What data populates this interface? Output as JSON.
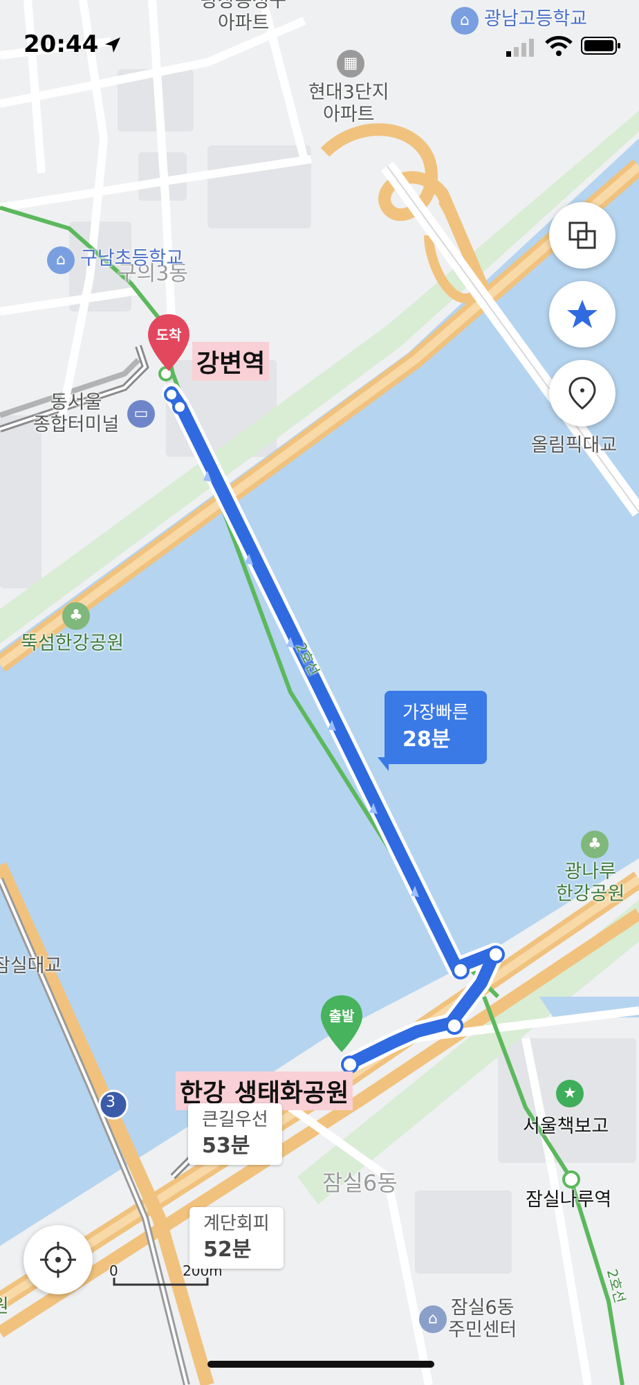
{
  "status_bar": {
    "time": "20:44"
  },
  "map": {
    "labels": {
      "apt_top": "광장동청구\n아파트",
      "school_top_right": "광남고등학교",
      "apt_hyundai": "현대3단지\n아파트",
      "school_guname": "구남초등학교",
      "dong_guui": "구의3동",
      "terminal": "동서울\n종합터미널",
      "park_ttukseom": "뚝섬한강공원",
      "bridge_olympic": "올림픽대교",
      "park_gwangnaru": "광나루\n한강공원",
      "bridge_jamsil": "잠실대교",
      "line2_tag": "2호선",
      "line2_tag_bottom": "2호선",
      "seoul_book": "서울책보고",
      "jamsil_naru": "잠실나루역",
      "dong_jamsil6": "잠실6동",
      "center_jamsil6": "잠실6동\n주민센터",
      "road_3": "3",
      "scale_0": "0",
      "scale_200": "200m",
      "edge_left": "원"
    },
    "destination": {
      "pin": "도착",
      "name": "강변역"
    },
    "origin": {
      "pin": "출발",
      "name": "한강 생태화공원"
    },
    "fastest": {
      "label": "가장빠른",
      "time": "28분"
    },
    "alt_routes": [
      {
        "label": "큰길우선",
        "time": "53분"
      },
      {
        "label": "계단회피",
        "time": "52분"
      }
    ],
    "colors": {
      "water": "#b5d4ef",
      "route": "#2f6ae0",
      "subway_green": "#5cb85c",
      "road": "#f1c27d",
      "accent_red": "#e2475e"
    }
  },
  "controls": {
    "layers_icon": "layers-icon",
    "favorite_icon": "star-icon",
    "place_icon": "location-pin-icon",
    "locate_icon": "crosshair-icon"
  }
}
